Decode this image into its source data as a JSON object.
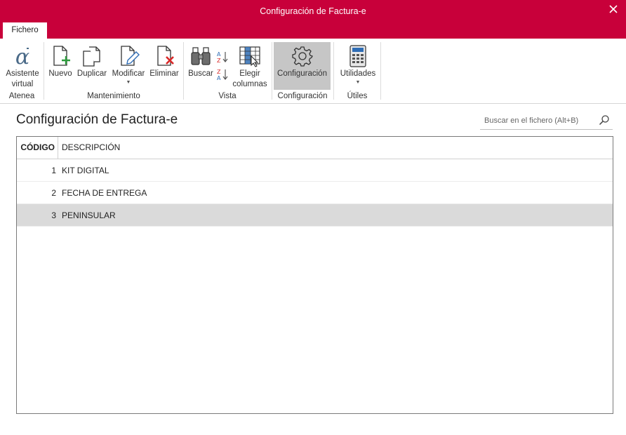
{
  "window": {
    "title": "Configuración de Factura-e"
  },
  "tabs": [
    {
      "label": "Fichero"
    }
  ],
  "ribbon": {
    "groups": [
      {
        "label": "Atenea",
        "buttons": [
          {
            "label": "Asistente virtual",
            "icon": "alpha-icon"
          }
        ]
      },
      {
        "label": "Mantenimiento",
        "buttons": [
          {
            "label": "Nuevo",
            "icon": "new-document-icon"
          },
          {
            "label": "Duplicar",
            "icon": "duplicate-icon"
          },
          {
            "label": "Modificar",
            "icon": "edit-document-icon",
            "dropdown": true
          },
          {
            "label": "Eliminar",
            "icon": "delete-document-icon"
          }
        ]
      },
      {
        "label": "Vista",
        "buttons": [
          {
            "label": "Buscar",
            "icon": "binoculars-icon"
          },
          {
            "label": "Elegir columnas",
            "icon": "columns-icon"
          }
        ]
      },
      {
        "label": "Configuración",
        "buttons": [
          {
            "label": "Configuración",
            "icon": "gear-icon",
            "active": true
          }
        ]
      },
      {
        "label": "Útiles",
        "buttons": [
          {
            "label": "Utilidades",
            "icon": "calculator-icon",
            "dropdown": true
          }
        ]
      }
    ]
  },
  "content": {
    "heading": "Configuración de Factura-e",
    "search": {
      "placeholder": "Buscar en el fichero (Alt+B)"
    },
    "grid": {
      "columns": [
        "CÓDIGO",
        "DESCRIPCIÓN"
      ],
      "rows": [
        {
          "codigo": "1",
          "descripcion": "KIT DIGITAL",
          "selected": false
        },
        {
          "codigo": "2",
          "descripcion": "FECHA DE ENTREGA",
          "selected": false
        },
        {
          "codigo": "3",
          "descripcion": "PENINSULAR",
          "selected": true
        }
      ]
    }
  },
  "colors": {
    "accent": "#c8003a",
    "selected_row": "#dadada",
    "active_button": "#c6c6c6"
  }
}
